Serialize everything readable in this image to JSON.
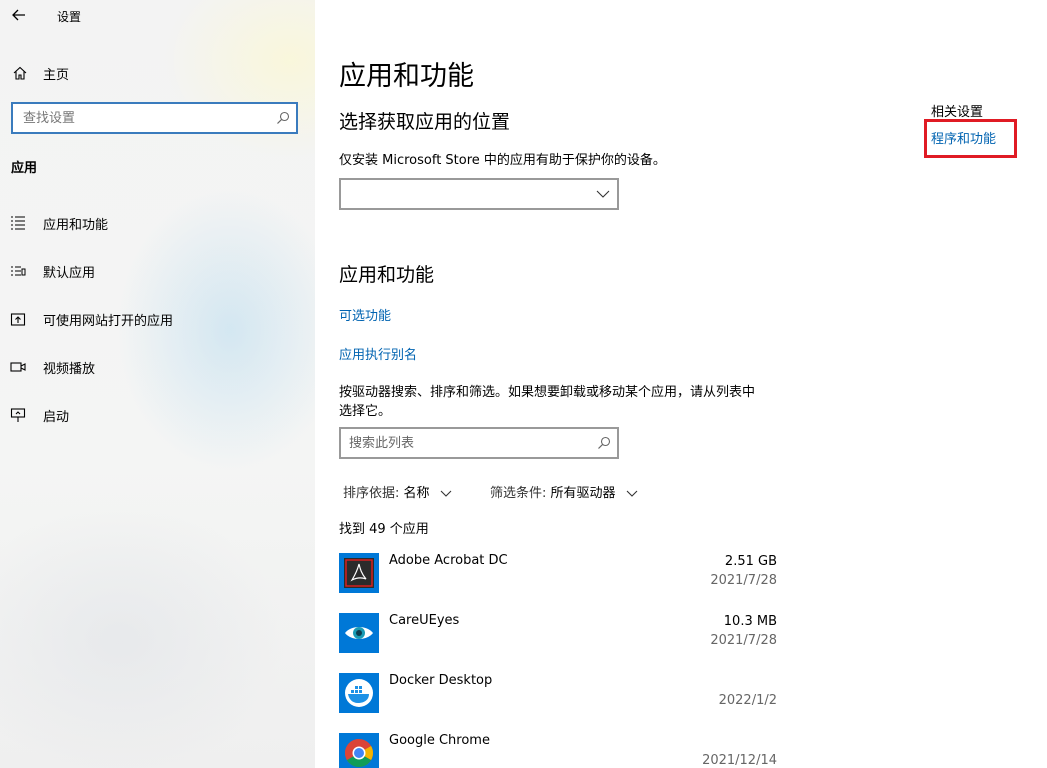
{
  "window": {
    "title": "设置"
  },
  "sidebar": {
    "home_label": "主页",
    "search_placeholder": "查找设置",
    "section_title": "应用",
    "items": [
      {
        "label": "应用和功能",
        "icon": "list-icon"
      },
      {
        "label": "默认应用",
        "icon": "default-apps-icon"
      },
      {
        "label": "可使用网站打开的应用",
        "icon": "open-in-app-icon"
      },
      {
        "label": "视频播放",
        "icon": "video-icon"
      },
      {
        "label": "启动",
        "icon": "startup-icon"
      }
    ]
  },
  "main": {
    "page_title": "应用和功能",
    "install_section": {
      "heading": "选择获取应用的位置",
      "description": "仅安装 Microsoft Store 中的应用有助于保护你的设备。",
      "dropdown_value": ""
    },
    "apps_section": {
      "heading": "应用和功能",
      "link_optional": "可选功能",
      "link_alias": "应用执行别名",
      "description_line1": "按驱动器搜索、排序和筛选。如果想要卸载或移动某个应用，请从列表中",
      "description_line2": "选择它。",
      "search_placeholder": "搜索此列表",
      "sort_label": "排序依据:",
      "sort_value": "名称",
      "filter_label": "筛选条件:",
      "filter_value": "所有驱动器",
      "found_text": "找到 49 个应用"
    },
    "apps": [
      {
        "name": "Adobe Acrobat DC",
        "size": "2.51 GB",
        "date": "2021/7/28",
        "icon": "acrobat-icon"
      },
      {
        "name": "CareUEyes",
        "size": "10.3 MB",
        "date": "2021/7/28",
        "icon": "eye-icon"
      },
      {
        "name": "Docker Desktop",
        "size": "",
        "date": "2022/1/2",
        "icon": "docker-icon"
      },
      {
        "name": "Google Chrome",
        "size": "",
        "date": "2021/12/14",
        "icon": "chrome-icon"
      }
    ]
  },
  "related": {
    "title": "相关设置",
    "link": "程序和功能"
  },
  "colors": {
    "accent": "#0063b1",
    "highlight_box": "#e01b24",
    "app_tile": "#0078d7"
  }
}
